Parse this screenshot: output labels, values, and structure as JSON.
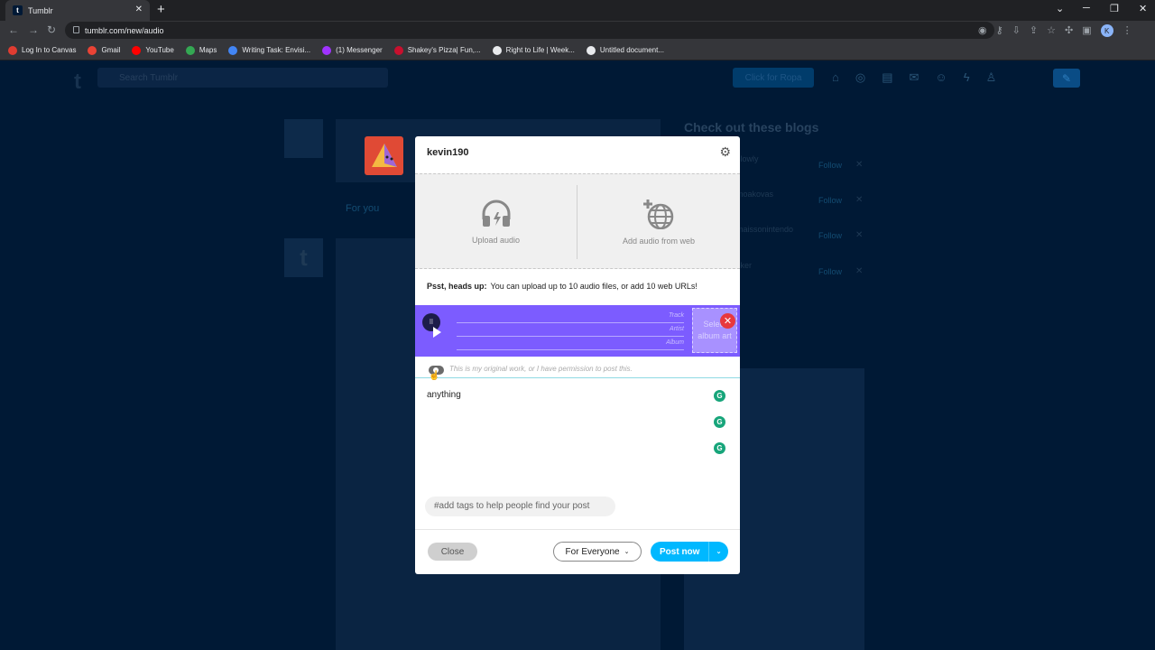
{
  "browser": {
    "tab_title": "Tumblr",
    "tab_icon": "t",
    "new_tab": "+",
    "url": "tumblr.com/new/audio",
    "profile_initial": "K"
  },
  "bookmarks": [
    {
      "label": "Log In to Canvas",
      "color": "#e03c31"
    },
    {
      "label": "Gmail",
      "color": "#ea4335"
    },
    {
      "label": "YouTube",
      "color": "#ff0000"
    },
    {
      "label": "Maps",
      "color": "#34a853"
    },
    {
      "label": "Writing Task: Envisi...",
      "color": "#4285f4"
    },
    {
      "label": "(1) Messenger",
      "color": "#a033ff"
    },
    {
      "label": "Shakey's Pizza| Fun,...",
      "color": "#c8102e"
    },
    {
      "label": "Right to Life | Week...",
      "color": "#e8eaed"
    },
    {
      "label": "Untitled document...",
      "color": "#e8eaed"
    }
  ],
  "background": {
    "search_placeholder": "Search Tumblr",
    "header_button": "Click for Ropa",
    "sidebar_heading": "Check out these blogs",
    "blogs": [
      {
        "name": "slowly",
        "follow": "Follow"
      },
      {
        "name": "moakovas",
        "follow": "Follow"
      },
      {
        "name": "maissonintendo",
        "follow": "Follow"
      },
      {
        "name": "cker",
        "follow": "Follow"
      }
    ]
  },
  "modal": {
    "username": "kevin190",
    "upload_label": "Upload audio",
    "web_label": "Add audio from web",
    "headsup_bold": "Psst, heads up:",
    "headsup_text": "You can upload up to 10 audio files, or add 10 web URLs!",
    "track_placeholder": "Track",
    "artist_placeholder": "Artist",
    "album_placeholder": "Album",
    "album_art_label": "Select album art",
    "original_work_label": "This is my original work, or I have permission to post this.",
    "body_text": "anything",
    "tags_placeholder": "#add tags to help people find your post",
    "close_label": "Close",
    "audience_label": "For Everyone",
    "post_label": "Post now"
  },
  "colors": {
    "page_bg": "#001935",
    "player": "#7c5cff",
    "post_button": "#00b8ff",
    "remove_button": "#e8383d"
  }
}
